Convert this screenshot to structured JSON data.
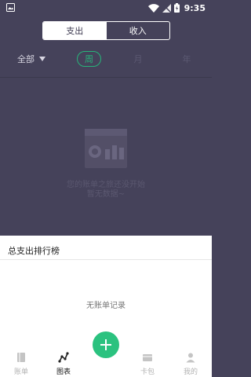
{
  "status_bar": {
    "time": "9:35"
  },
  "toggle": {
    "expense": "支出",
    "income": "收入",
    "selected": "支出"
  },
  "filter": {
    "category": "全部",
    "periods": {
      "week": "周",
      "month": "月",
      "year": "年"
    },
    "selected_period": "周"
  },
  "empty_chart": {
    "line1": "您的账单之旅还没开始",
    "line2": "暂无数据~"
  },
  "ranking": {
    "title": "总支出排行榜",
    "empty": "无账单记录"
  },
  "tabbar": {
    "items": [
      {
        "label": "账单",
        "icon": "book-icon"
      },
      {
        "label": "图表",
        "icon": "chart-line-icon"
      },
      {
        "label": "卡包",
        "icon": "card-icon"
      },
      {
        "label": "我的",
        "icon": "person-icon"
      }
    ],
    "active": "图表"
  },
  "colors": {
    "background": "#45425a",
    "accent": "#2bc27f",
    "panel": "#ffffff"
  }
}
